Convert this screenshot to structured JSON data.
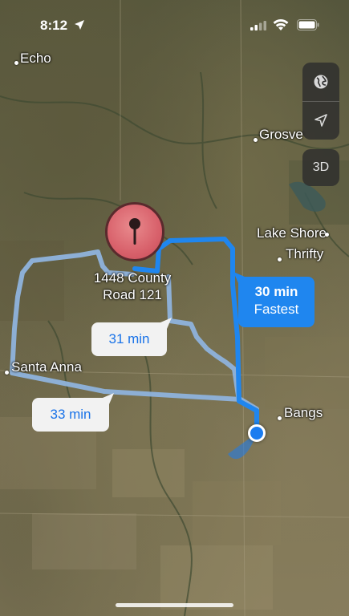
{
  "status_bar": {
    "time": "8:12"
  },
  "map": {
    "controls": {
      "map_mode_icon": "globe-icon",
      "tracking_icon": "location-arrow-icon",
      "three_d_label": "3D"
    },
    "places": [
      {
        "name": "Echo"
      },
      {
        "name": "Grosve"
      },
      {
        "name": "Lake Shore"
      },
      {
        "name": "Thrifty"
      },
      {
        "name": "Santa Anna"
      },
      {
        "name": "Bangs"
      }
    ],
    "destination": {
      "label_line1": "1448 County",
      "label_line2": "Road 121",
      "pin_color": "#d8616b"
    },
    "routes": [
      {
        "time": "30 min",
        "tag": "Fastest",
        "selected": true,
        "color": "#1f86ef"
      },
      {
        "time": "31 min",
        "selected": false,
        "color": "#8fb3dd"
      },
      {
        "time": "33 min",
        "selected": false,
        "color": "#8fb3dd"
      }
    ]
  }
}
